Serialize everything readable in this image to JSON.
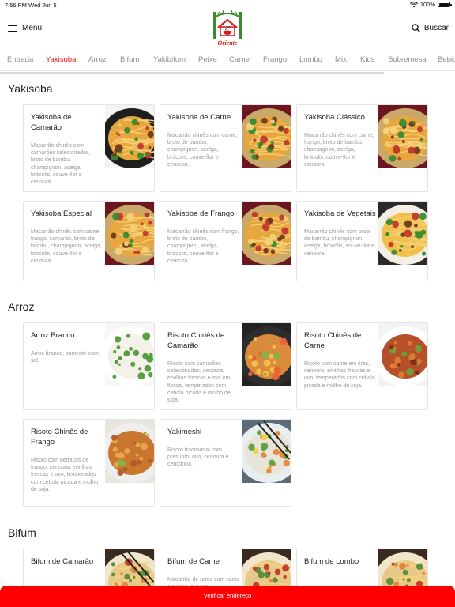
{
  "status_bar": {
    "time": "7:56 PM",
    "date": "Wed Jun 5",
    "battery": "100%"
  },
  "header": {
    "menu_label": "Menu",
    "search_label": "Buscar",
    "logo_text": "Oriente"
  },
  "tabs": [
    "Entrada",
    "Yakisoba",
    "Arroz",
    "Bifum",
    "Yakibifum",
    "Peixe",
    "Carne",
    "Frango",
    "Lombo",
    "Mix",
    "Kids",
    "Sobremesa",
    "Bebidas"
  ],
  "active_tab": "Yakisoba",
  "sections": [
    {
      "title": "Yakisoba",
      "items": [
        {
          "name": "Yakisoba de Camarão",
          "description": "Macarrão chinês com camarões selecionados, broto de bambu, champignon, acelga, brócolis, couve-flor e cenoura.",
          "photo": "noodles-shrimp"
        },
        {
          "name": "Yakisoba de Carne",
          "description": "Macarrão chinês com carne, broto de bambu, champignon, acelga, brócolis, couve-flor e cenoura.",
          "photo": "noodles-beef"
        },
        {
          "name": "Yakisoba Clássico",
          "description": "Macarrão chinês com carne, frango, broto de bambu, champignon, acelga, brócolis, couve-flor e cenoura.",
          "photo": "noodles-classic"
        },
        {
          "name": "Yakisoba Especial",
          "description": "Macarrão chinês com carne, frango, camarão, broto de bambu, champignon, acelga, brócolis, couve-flor e cenoura.",
          "photo": "noodles-special"
        },
        {
          "name": "Yakisoba de Frango",
          "description": "Macarrão chinês com frango, broto de bambu, champignon, acelga, brócolis, couve-flor e cenoura.",
          "photo": "noodles-chicken"
        },
        {
          "name": "Yakisoba de Vegetais",
          "description": "Macarrão chinês com broto de bambu, champignon, acelga, brócolis, couve-flor e cenoura.",
          "photo": "noodles-veg"
        }
      ]
    },
    {
      "title": "Arroz",
      "items": [
        {
          "name": "Arroz Branco",
          "description": "Arroz branco, somente com sal.",
          "photo": "rice-white"
        },
        {
          "name": "Risoto Chinês de Camarão",
          "description": "Risoto com camarões selecionados, cenoura, ervilhas frescas e ovo em flocos, temperados com cebola picada e molho de soja.",
          "photo": "rice-shrimp"
        },
        {
          "name": "Risoto Chinês de Carne",
          "description": "Risoto com carne em tiras, cenoura, ervilhas frescas e ovo, temperados com cebola picada e molho de soja.",
          "photo": "rice-beef"
        },
        {
          "name": "Risoto Chinês de Frango",
          "description": "Risoto com pedaços de frango, cenoura, ervilhas frescas e ovo, temperados com cebola picada e molho de soja.",
          "photo": "rice-chicken"
        },
        {
          "name": "Yakimeshi",
          "description": "Risoto tradicional com presunto, ovo, cenoura e cebolinha.",
          "photo": "rice-yakimeshi"
        }
      ]
    },
    {
      "title": "Bifum",
      "items": [
        {
          "name": "Bifum de Camarão",
          "description": "",
          "photo": "bifum-shrimp"
        },
        {
          "name": "Bifum de Carne",
          "description": "Macarrão de arroz com carne em tiras, ovo em",
          "photo": "bifum-beef"
        },
        {
          "name": "Bifum de Lombo",
          "description": "",
          "photo": "bifum-pork"
        }
      ]
    }
  ],
  "cta_label": "Verificar endereço",
  "colors": {
    "accent": "#e21b1b",
    "cta": "#ff0000"
  }
}
